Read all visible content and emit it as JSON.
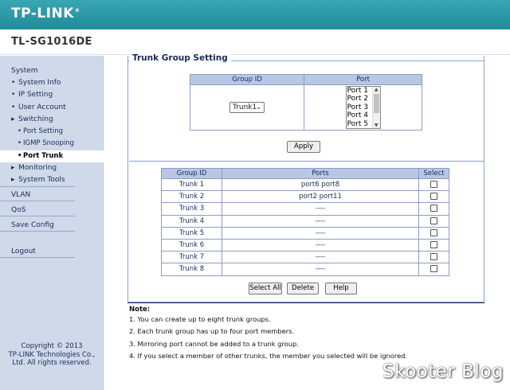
{
  "brand": {
    "logo_text": "TP-LINK",
    "logo_mark": "®",
    "model": "TL-SG1016DE"
  },
  "sidebar": {
    "system_header": "System",
    "items": [
      {
        "label": "System Info",
        "bullet": "•"
      },
      {
        "label": "IP Setting",
        "bullet": "•"
      },
      {
        "label": "User Account",
        "bullet": "•"
      },
      {
        "label": "Switching",
        "bullet": "▸"
      },
      {
        "label": "Port Setting",
        "bullet": "•"
      },
      {
        "label": "IGMP Snooping",
        "bullet": "•"
      },
      {
        "label": "Port Trunk",
        "bullet": "•"
      },
      {
        "label": "Monitoring",
        "bullet": "▸"
      },
      {
        "label": "System Tools",
        "bullet": "▸"
      }
    ],
    "sections": [
      "VLAN",
      "QoS",
      "Save Config"
    ],
    "logout": "Logout",
    "copyright_lines": [
      "Copyright © 2013",
      "TP-LINK Technologies Co.,",
      "Ltd. All rights reserved."
    ]
  },
  "trunk": {
    "legend": "Trunk Group Setting",
    "col_group": "Group ID",
    "col_port": "Port",
    "group_selected": "Trunk1",
    "ports_visible": [
      "Port 1",
      "Port 2",
      "Port 3",
      "Port 4",
      "Port 5"
    ],
    "apply_label": "Apply"
  },
  "table": {
    "headers": [
      "Group ID",
      "Ports",
      "Select"
    ],
    "rows": [
      {
        "group": "Trunk 1",
        "ports": "port6 port8"
      },
      {
        "group": "Trunk 2",
        "ports": "port2 port11"
      },
      {
        "group": "Trunk 3",
        "ports": "----"
      },
      {
        "group": "Trunk 4",
        "ports": "----"
      },
      {
        "group": "Trunk 5",
        "ports": "----"
      },
      {
        "group": "Trunk 6",
        "ports": "----"
      },
      {
        "group": "Trunk 7",
        "ports": "----"
      },
      {
        "group": "Trunk 8",
        "ports": "----"
      }
    ],
    "select_all_label": "Select All",
    "delete_label": "Delete",
    "help_label": "Help"
  },
  "notes": {
    "title": "Note:",
    "lines": [
      "1. You can create up to eight trunk groups.",
      "2. Each trunk group has up to four port members.",
      "3. Mirroring port cannot be added to a trunk group.",
      "4. If you select a member of other trunks, the member you selected will be ignored."
    ]
  },
  "watermark": "Skooter Blog",
  "colors": {
    "header": "#2a9aa8",
    "sidebar": "#cfd9ea",
    "table_header": "#b9c6e6",
    "nav_text": "#1a2b55"
  }
}
